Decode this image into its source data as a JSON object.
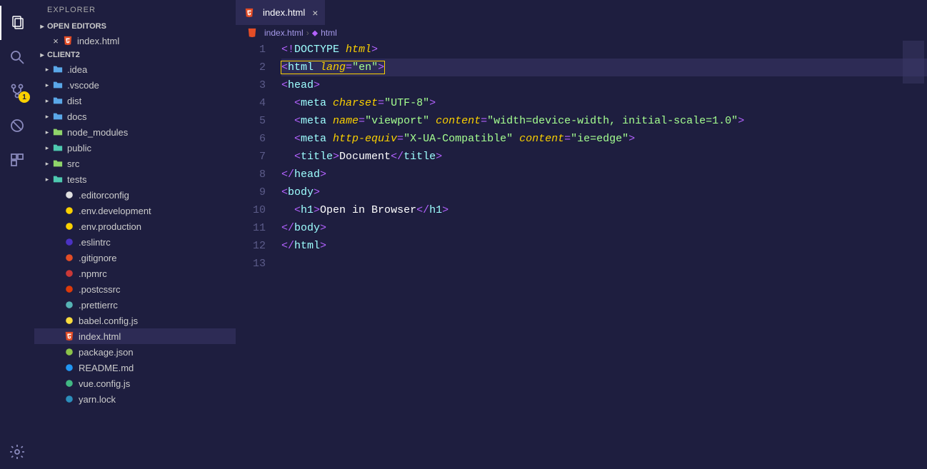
{
  "sidebar": {
    "title": "EXPLORER",
    "openEditors": {
      "header": "OPEN EDITORS",
      "items": [
        {
          "name": "index.html",
          "icon": "html"
        }
      ]
    },
    "project": {
      "header": "CLIENT2",
      "tree": [
        {
          "type": "folder",
          "name": ".idea",
          "iconColor": "folder-blue"
        },
        {
          "type": "folder",
          "name": ".vscode",
          "iconColor": "folder-blue"
        },
        {
          "type": "folder",
          "name": "dist",
          "iconColor": "folder-blue"
        },
        {
          "type": "folder",
          "name": "docs",
          "iconColor": "folder-blue"
        },
        {
          "type": "folder",
          "name": "node_modules",
          "iconColor": "folder-lime"
        },
        {
          "type": "folder",
          "name": "public",
          "iconColor": "folder-cyan"
        },
        {
          "type": "folder",
          "name": "src",
          "iconColor": "folder-lime"
        },
        {
          "type": "folder",
          "name": "tests",
          "iconColor": "folder-cyan"
        },
        {
          "type": "file",
          "name": ".editorconfig",
          "icon": "editorconfig"
        },
        {
          "type": "file",
          "name": ".env.development",
          "icon": "env"
        },
        {
          "type": "file",
          "name": ".env.production",
          "icon": "env"
        },
        {
          "type": "file",
          "name": ".eslintrc",
          "icon": "eslint"
        },
        {
          "type": "file",
          "name": ".gitignore",
          "icon": "git"
        },
        {
          "type": "file",
          "name": ".npmrc",
          "icon": "npm"
        },
        {
          "type": "file",
          "name": ".postcssrc",
          "icon": "postcss"
        },
        {
          "type": "file",
          "name": ".prettierrc",
          "icon": "prettier"
        },
        {
          "type": "file",
          "name": "babel.config.js",
          "icon": "babel"
        },
        {
          "type": "file",
          "name": "index.html",
          "icon": "html",
          "selected": true
        },
        {
          "type": "file",
          "name": "package.json",
          "icon": "json"
        },
        {
          "type": "file",
          "name": "README.md",
          "icon": "info"
        },
        {
          "type": "file",
          "name": "vue.config.js",
          "icon": "vue"
        },
        {
          "type": "file",
          "name": "yarn.lock",
          "icon": "yarn"
        }
      ]
    }
  },
  "activityBadge": {
    "scm": "1"
  },
  "tab": {
    "name": "index.html"
  },
  "breadcrumb": {
    "file": "index.html",
    "symbol": "html"
  },
  "code": {
    "lines": [
      {
        "n": 1,
        "tokens": [
          [
            "<!",
            "p-punc"
          ],
          [
            "DOCTYPE ",
            "p-tag"
          ],
          [
            "html",
            "p-attr"
          ],
          [
            ">",
            "p-punc"
          ]
        ]
      },
      {
        "n": 2,
        "hl": true,
        "tokens": [
          [
            "<",
            "p-punc"
          ],
          [
            "html ",
            "p-tag"
          ],
          [
            "lang",
            "p-attr"
          ],
          [
            "=",
            "p-punc"
          ],
          [
            "\"en\"",
            "p-str"
          ],
          [
            ">",
            "p-punc"
          ]
        ]
      },
      {
        "n": 3,
        "tokens": [
          [
            "<",
            "p-punc"
          ],
          [
            "head",
            "p-tag"
          ],
          [
            ">",
            "p-punc"
          ]
        ]
      },
      {
        "n": 4,
        "tokens": [
          [
            "  <",
            "p-punc"
          ],
          [
            "meta ",
            "p-tag"
          ],
          [
            "charset",
            "p-attr"
          ],
          [
            "=",
            "p-punc"
          ],
          [
            "\"UTF-8\"",
            "p-str"
          ],
          [
            ">",
            "p-punc"
          ]
        ]
      },
      {
        "n": 5,
        "tokens": [
          [
            "  <",
            "p-punc"
          ],
          [
            "meta ",
            "p-tag"
          ],
          [
            "name",
            "p-attr"
          ],
          [
            "=",
            "p-punc"
          ],
          [
            "\"viewport\" ",
            "p-str"
          ],
          [
            "content",
            "p-attr"
          ],
          [
            "=",
            "p-punc"
          ],
          [
            "\"width=device-width, initial-scale=1.0\"",
            "p-str"
          ],
          [
            ">",
            "p-punc"
          ]
        ]
      },
      {
        "n": 6,
        "tokens": [
          [
            "  <",
            "p-punc"
          ],
          [
            "meta ",
            "p-tag"
          ],
          [
            "http-equiv",
            "p-attr"
          ],
          [
            "=",
            "p-punc"
          ],
          [
            "\"X-UA-Compatible\" ",
            "p-str"
          ],
          [
            "content",
            "p-attr"
          ],
          [
            "=",
            "p-punc"
          ],
          [
            "\"ie=edge\"",
            "p-str"
          ],
          [
            ">",
            "p-punc"
          ]
        ]
      },
      {
        "n": 7,
        "tokens": [
          [
            "  <",
            "p-punc"
          ],
          [
            "title",
            "p-tag"
          ],
          [
            ">",
            "p-punc"
          ],
          [
            "Document",
            "p-txt"
          ],
          [
            "</",
            "p-punc"
          ],
          [
            "title",
            "p-tag"
          ],
          [
            ">",
            "p-punc"
          ]
        ]
      },
      {
        "n": 8,
        "tokens": [
          [
            "</",
            "p-punc"
          ],
          [
            "head",
            "p-tag"
          ],
          [
            ">",
            "p-punc"
          ]
        ]
      },
      {
        "n": 9,
        "tokens": [
          [
            "<",
            "p-punc"
          ],
          [
            "body",
            "p-tag"
          ],
          [
            ">",
            "p-punc"
          ]
        ]
      },
      {
        "n": 10,
        "tokens": [
          [
            "  <",
            "p-punc"
          ],
          [
            "h1",
            "p-tag"
          ],
          [
            ">",
            "p-punc"
          ],
          [
            "Open in Browser",
            "p-txt"
          ],
          [
            "</",
            "p-punc"
          ],
          [
            "h1",
            "p-tag"
          ],
          [
            ">",
            "p-punc"
          ]
        ]
      },
      {
        "n": 11,
        "tokens": [
          [
            "</",
            "p-punc"
          ],
          [
            "body",
            "p-tag"
          ],
          [
            ">",
            "p-punc"
          ]
        ]
      },
      {
        "n": 12,
        "tokens": [
          [
            "</",
            "p-punc"
          ],
          [
            "html",
            "p-tag"
          ],
          [
            ">",
            "p-punc"
          ]
        ]
      },
      {
        "n": 13,
        "tokens": []
      }
    ]
  },
  "icons": {
    "html": "#e44d26",
    "editorconfig": "#e0e0e0",
    "env": "#fad000",
    "eslint": "#4b32c3",
    "git": "#e44d26",
    "npm": "#cb3837",
    "postcss": "#dd3a0a",
    "prettier": "#56b3b4",
    "babel": "#f9dc3e",
    "json": "#8bc34a",
    "info": "#2196f3",
    "vue": "#41b883",
    "yarn": "#2c8ebb"
  }
}
